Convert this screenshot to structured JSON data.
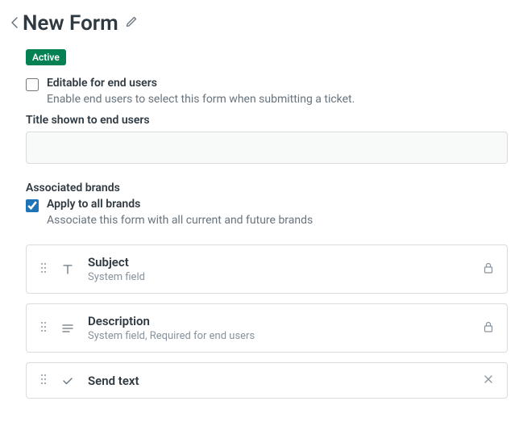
{
  "header": {
    "title": "New Form"
  },
  "status": {
    "badge": "Active"
  },
  "editable": {
    "label": "Editable for end users",
    "desc": "Enable end users to select this form when submitting a ticket.",
    "checked": false
  },
  "titleField": {
    "label": "Title shown to end users",
    "value": ""
  },
  "brands": {
    "heading": "Associated brands",
    "applyAll": {
      "label": "Apply to all brands",
      "desc": "Associate this form with all current and future brands",
      "checked": true
    }
  },
  "fields": [
    {
      "title": "Subject",
      "sub": "System field",
      "typeIcon": "text",
      "endIcon": "lock"
    },
    {
      "title": "Description",
      "sub": "System field, Required for end users",
      "typeIcon": "multiline",
      "endIcon": "lock"
    },
    {
      "title": "Send text",
      "sub": "",
      "typeIcon": "check",
      "endIcon": "close"
    }
  ]
}
